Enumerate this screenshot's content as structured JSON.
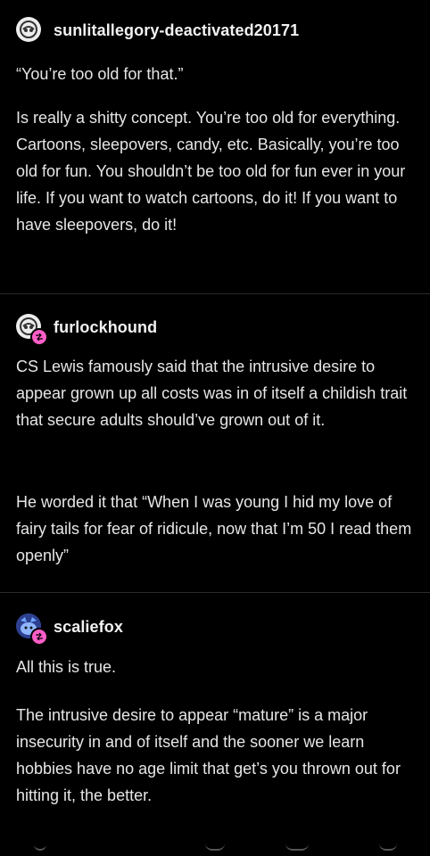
{
  "posts": [
    {
      "username": "sunlitallegory-deactivated20171",
      "avatar_icon": "deactivated-avatar-icon",
      "paragraphs": [
        "“You’re too old for that.”",
        "Is really a shitty concept. You’re too old for everything. Cartoons, sleepovers, candy, etc. Basically, you’re too old for fun. You shouldn’t be too old for fun ever in your life. If you want to watch cartoons, do it! If you want to have sleepovers, do it!"
      ]
    },
    {
      "username": "furlockhound",
      "avatar_icon": "deactivated-avatar-icon",
      "paragraphs": [
        "CS Lewis famously said that the intrusive desire to appear grown up all costs was in of itself a childish trait that secure adults should’ve grown out of it.",
        "He worded it that “When I was young I hid my love of fairy tails for fear of ridicule, now that I’m 50 I read them openly”"
      ]
    },
    {
      "username": "scaliefox",
      "avatar_icon": "fox-avatar-icon",
      "paragraphs": [
        "All this is true.",
        "The intrusive desire to appear “mature” is a major insecurity in and of itself and the sooner we learn hobbies have no age limit that get’s you thrown out for hitting it, the better."
      ]
    }
  ],
  "colors": {
    "background": "#000000",
    "text": "#e6e6e6",
    "divider": "#2a2a2a",
    "reblog_badge": "#ff5ec8"
  }
}
